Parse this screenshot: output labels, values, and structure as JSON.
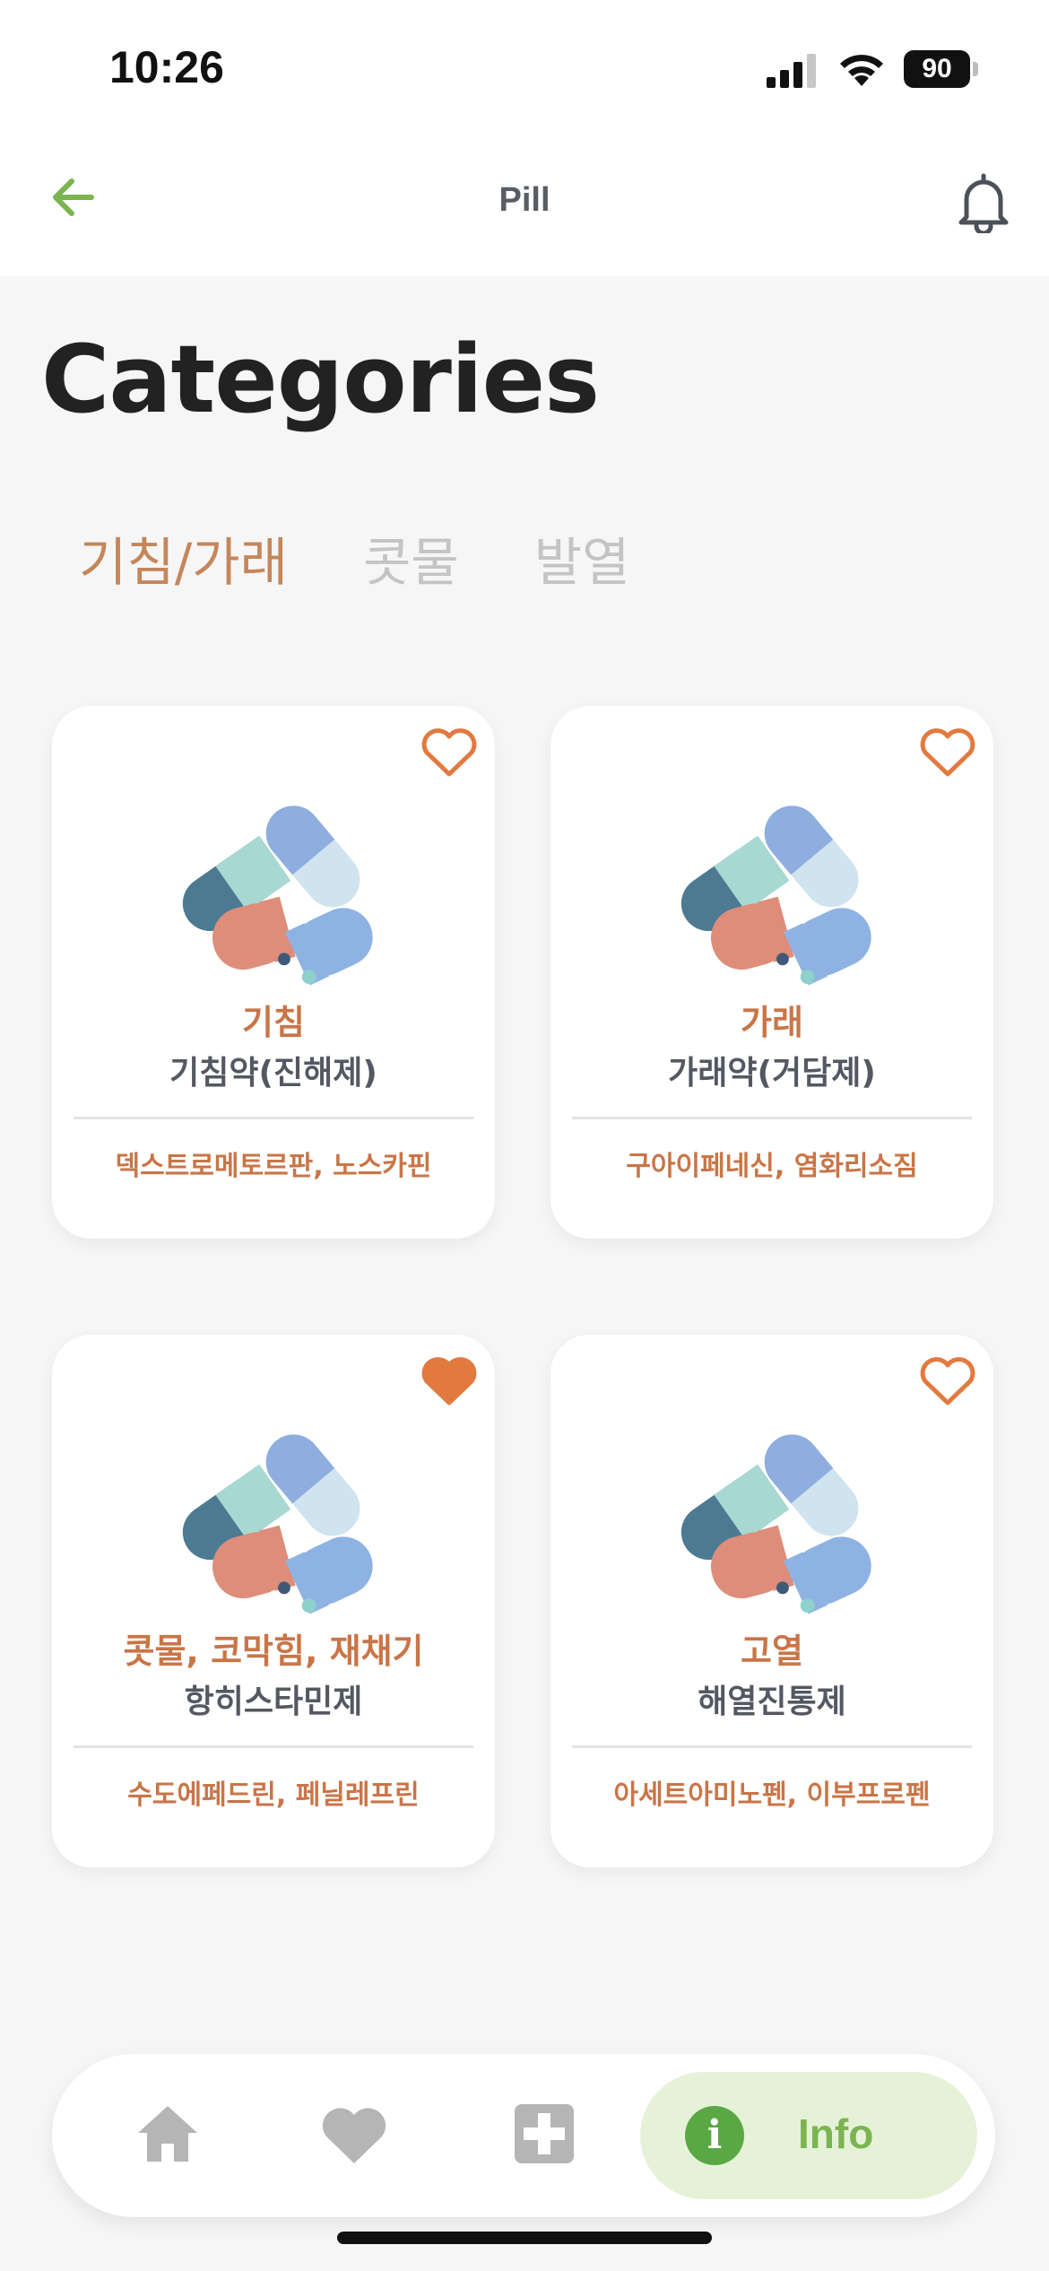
{
  "status": {
    "time": "10:26",
    "battery": "90"
  },
  "header": {
    "title": "Pill",
    "back_icon": "arrow-left-icon",
    "bell_icon": "bell-icon"
  },
  "page": {
    "title": "Categories"
  },
  "tabs": [
    {
      "label": "기침/가래",
      "active": true
    },
    {
      "label": "콧물",
      "active": false
    },
    {
      "label": "발열",
      "active": false
    }
  ],
  "cards": [
    {
      "name": "기침",
      "type": "기침약(진해제)",
      "ingredients": "덱스트로메토르판, 노스카핀",
      "favorited": false
    },
    {
      "name": "가래",
      "type": "가래약(거담제)",
      "ingredients": "구아이페네신, 염화리소짐",
      "favorited": false
    },
    {
      "name": "콧물, 코막힘, 재채기",
      "type": "항히스타민제",
      "ingredients": "수도에페드린, 페닐레프린",
      "favorited": true
    },
    {
      "name": "고열",
      "type": "해열진통제",
      "ingredients": "아세트아미노펜, 이부프로펜",
      "favorited": false
    }
  ],
  "colors": {
    "accent": "#c97547",
    "heart": "#e27a3f",
    "green": "#7bb451"
  },
  "bottom_nav": {
    "items": [
      {
        "icon": "home-icon"
      },
      {
        "icon": "heart-icon"
      },
      {
        "icon": "plus-box-icon"
      }
    ],
    "active": {
      "icon": "info-icon",
      "label": "Info"
    }
  }
}
